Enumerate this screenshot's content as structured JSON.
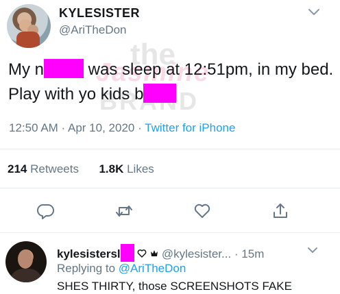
{
  "tweet": {
    "display_name": "KYLESISTER",
    "handle": "@AriTheDon",
    "watermark": {
      "line1": "the",
      "line2": "Jasmine",
      "line3": "BRAND"
    },
    "text": {
      "part1": "My n",
      "part2": " was sleep at 12:51pm, in my bed. Play with yo kids b"
    },
    "time": "12:50 AM",
    "sep1": " · ",
    "date": "Apr 10, 2020",
    "sep2": " · ",
    "source": "Twitter for iPhone",
    "retweets_count": "214",
    "retweets_label": " Retweets",
    "likes_count": "1.8K",
    "likes_label": " Likes"
  },
  "actions": [
    {
      "name": "reply",
      "icon": "reply-icon"
    },
    {
      "name": "retweet",
      "icon": "retweet-icon"
    },
    {
      "name": "like",
      "icon": "heart-icon"
    },
    {
      "name": "share",
      "icon": "share-icon"
    }
  ],
  "reply": {
    "display_name_start": "kylesistersl",
    "display_name_end": "",
    "handle": "@kylesister...",
    "time_sep": " · ",
    "time": "15m",
    "replying_prefix": "Replying to ",
    "replying_mention": "@AriTheDon",
    "text": "SHES THIRTY, those SCREENSHOTS FAKE"
  },
  "colors": {
    "accent": "#1da1f2",
    "redaction": "#ff00ff",
    "secondary_text": "#657786",
    "primary_text": "#14171a"
  }
}
